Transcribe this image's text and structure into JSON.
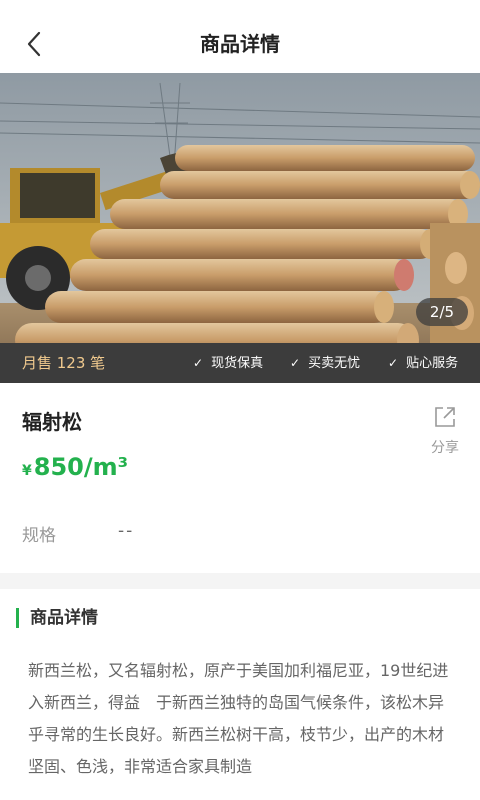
{
  "header": {
    "title": "商品详情",
    "back_icon": "chevron-left-icon"
  },
  "gallery": {
    "page_indicator": "2/5"
  },
  "promo_bar": {
    "monthly_sales": "月售 123 笔",
    "badges": [
      "现货保真",
      "买卖无忧",
      "贴心服务"
    ],
    "badge_icon": "check-icon"
  },
  "product": {
    "name": "辐射松",
    "currency": "¥",
    "price": "850/m³",
    "price_color": "#23b14d",
    "share_label": "分享",
    "spec_label": "规格",
    "spec_value": "--"
  },
  "detail": {
    "section_title": "商品详情",
    "text": "新西兰松，又名辐射松，原产于美国加利福尼亚，19世纪进入新西兰，得益　于新西兰独特的岛国气候条件，该松木异乎寻常的生长良好。新西兰松树干高，枝节少，出产的木材坚固、色浅，非常适合家具制造"
  }
}
